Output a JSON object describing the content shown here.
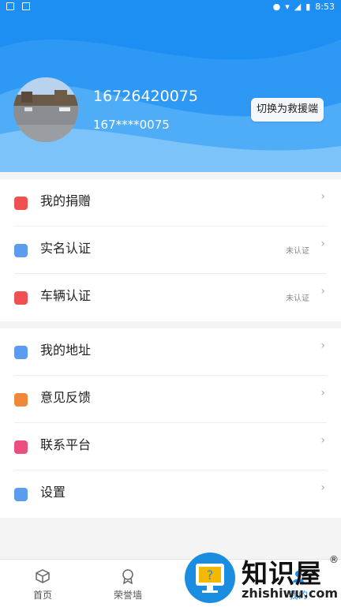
{
  "statusbar": {
    "time": "8:53"
  },
  "profile": {
    "phone": "16726420075",
    "masked_phone": "167****0075",
    "switch_button": "切换为救援端"
  },
  "groups": [
    {
      "items": [
        {
          "label": "我的捐赠",
          "icon": "donation-icon",
          "color": "#f05050",
          "status": ""
        },
        {
          "label": "实名认证",
          "icon": "verify-icon",
          "color": "#5b9bf0",
          "status": "未认证"
        },
        {
          "label": "车辆认证",
          "icon": "car-icon",
          "color": "#f05050",
          "status": "未认证"
        }
      ]
    },
    {
      "items": [
        {
          "label": "我的地址",
          "icon": "location-icon",
          "color": "#5b9bf0",
          "status": ""
        },
        {
          "label": "意见反馈",
          "icon": "feedback-icon",
          "color": "#f0883a",
          "status": ""
        },
        {
          "label": "联系平台",
          "icon": "info-icon",
          "color": "#ea4f7e",
          "status": ""
        },
        {
          "label": "设置",
          "icon": "settings-icon",
          "color": "#5b9bf0",
          "status": ""
        }
      ]
    }
  ],
  "tabbar": {
    "home": "首页",
    "honor": "荣誉墙",
    "mine": "我的"
  },
  "watermark": {
    "title": "知识屋",
    "url": "zhishiwu.com",
    "reg": "®"
  },
  "colors": {
    "primary": "#1d8ff2"
  }
}
